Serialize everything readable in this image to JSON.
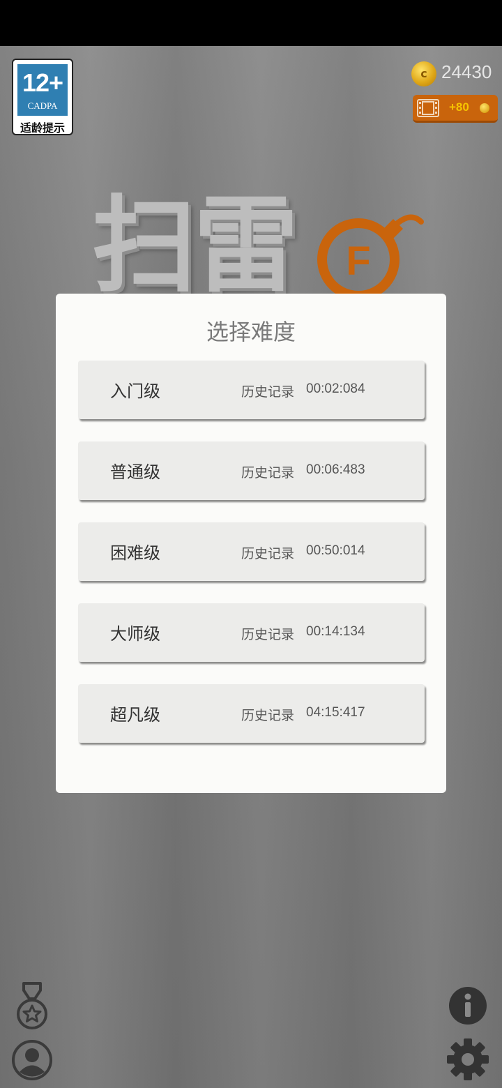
{
  "age_rating": {
    "number": "12+",
    "org": "CADPA",
    "tip": "适龄提示"
  },
  "coins": {
    "icon": "coin-icon",
    "count": "24430"
  },
  "ad_reward": {
    "icon": "film-icon",
    "label": "+80"
  },
  "logo": {
    "text": "扫雷",
    "badge_letter": "F"
  },
  "dialog": {
    "title": "选择难度",
    "levels": [
      {
        "name": "入门级",
        "record_label": "历史记录",
        "record_time": "00:02:084"
      },
      {
        "name": "普通级",
        "record_label": "历史记录",
        "record_time": "00:06:483"
      },
      {
        "name": "困难级",
        "record_label": "历史记录",
        "record_time": "00:50:014"
      },
      {
        "name": "大师级",
        "record_label": "历史记录",
        "record_time": "00:14:134"
      },
      {
        "name": "超凡级",
        "record_label": "历史记录",
        "record_time": "04:15:417"
      }
    ]
  },
  "bottom_icons": {
    "left": [
      "medal-icon",
      "profile-icon"
    ],
    "right": [
      "info-icon",
      "gear-icon"
    ]
  },
  "colors": {
    "accent_orange": "#c9640c",
    "coin_gold": "#e0a818",
    "dialog_bg": "#fbfbf9",
    "button_bg": "#ececea"
  }
}
